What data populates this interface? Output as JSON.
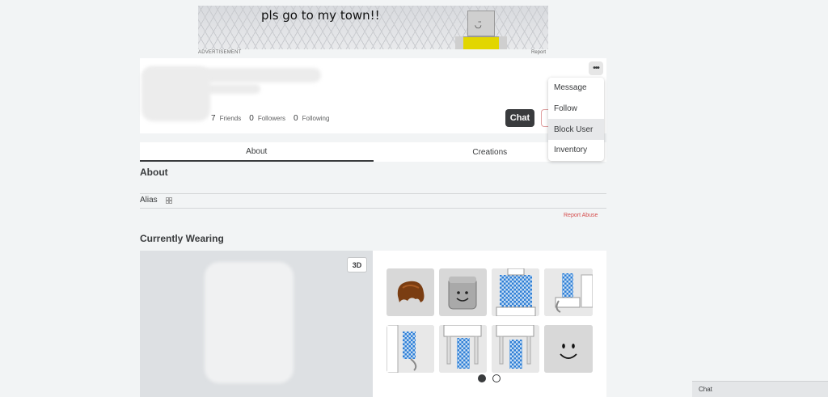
{
  "ad": {
    "text": "pls go to my town!!",
    "label": "ADVERTISEMENT",
    "report": "Report",
    "face": "◡̈"
  },
  "profile": {
    "friends_count": "7",
    "friends_label": "Friends",
    "followers_count": "0",
    "followers_label": "Followers",
    "following_count": "0",
    "following_label": "Following",
    "chat_button": "Chat",
    "more_button": "•••"
  },
  "menu": {
    "items": [
      "Message",
      "Follow",
      "Block User",
      "Inventory"
    ],
    "hovered": "Block User"
  },
  "tabs": [
    "About",
    "Creations"
  ],
  "about": {
    "heading": "About",
    "alias_label": "Alias",
    "report_link": "Report Abuse"
  },
  "wearing": {
    "heading": "Currently Wearing",
    "view_toggle": "3D",
    "items": [
      {
        "icon": "hair-icon"
      },
      {
        "icon": "head-icon"
      },
      {
        "icon": "shirt-icon"
      },
      {
        "icon": "right-arm-icon"
      },
      {
        "icon": "left-arm-icon"
      },
      {
        "icon": "left-leg-icon"
      },
      {
        "icon": "right-leg-icon"
      },
      {
        "icon": "face-icon"
      }
    ],
    "page_count": 2,
    "current_page": 1
  },
  "chat_bar": {
    "label": "Chat"
  },
  "colors": {
    "background": "#f2f4f5",
    "accent_dark": "#393b3d",
    "report_red": "#d54c4c",
    "checker_blue": "#2f7fd6"
  }
}
